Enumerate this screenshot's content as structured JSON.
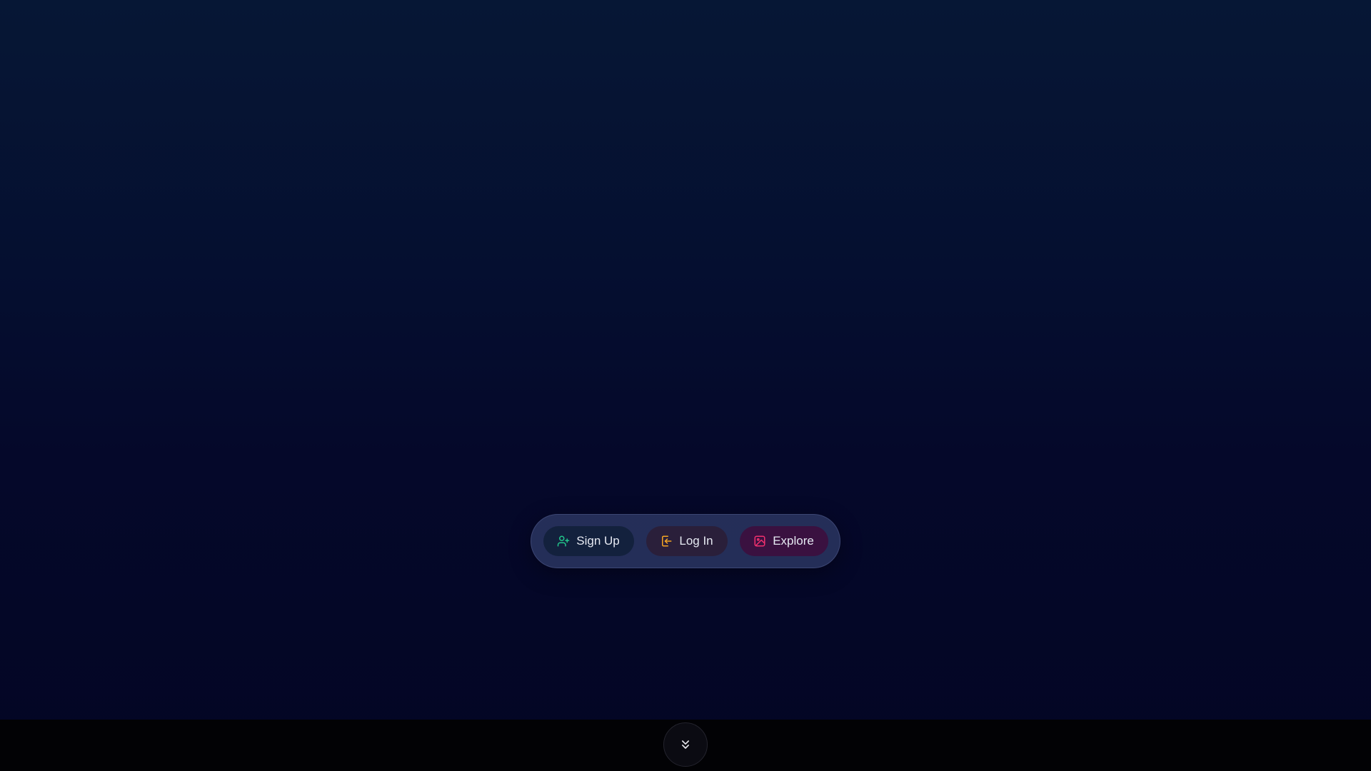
{
  "actions": {
    "signup": {
      "label": "Sign Up",
      "icon": "user-plus-icon",
      "color": "#22c58b"
    },
    "login": {
      "label": "Log In",
      "icon": "log-in-icon",
      "color": "#f5a524"
    },
    "explore": {
      "label": "Explore",
      "icon": "image-icon",
      "color": "#f0306e"
    }
  },
  "scroll": {
    "icon": "chevrons-down-icon"
  }
}
